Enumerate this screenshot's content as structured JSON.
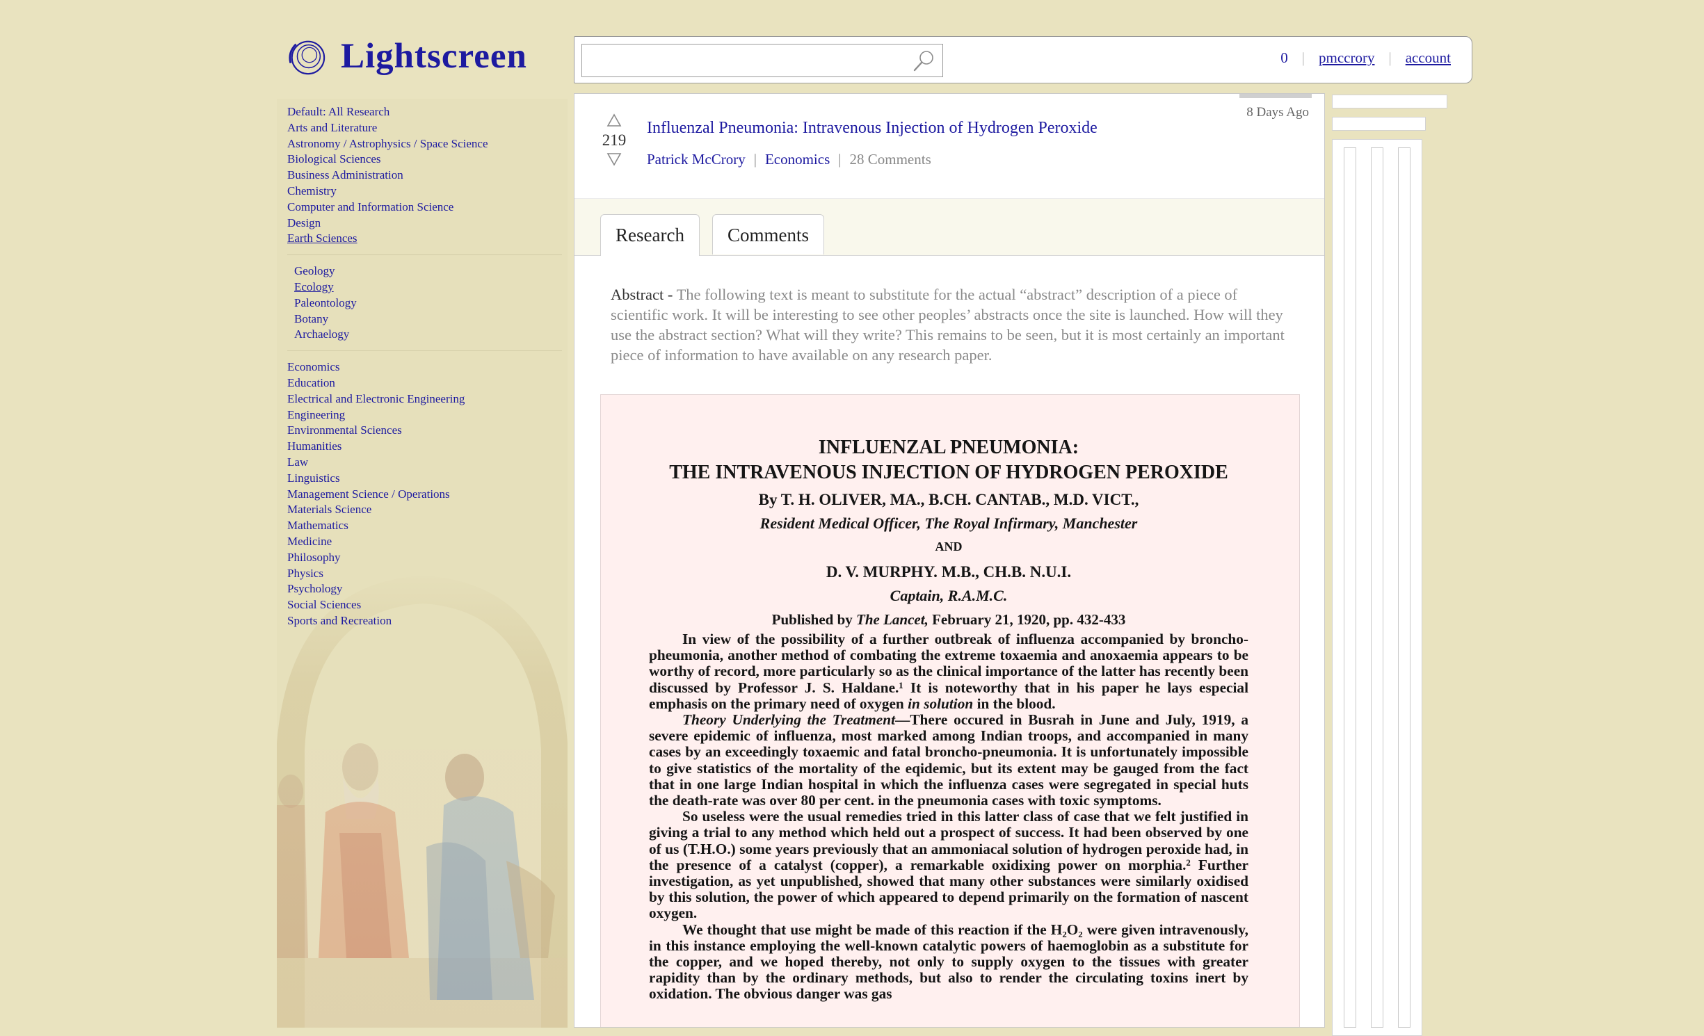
{
  "app": {
    "name": "Lightscreen",
    "logo_icon": "spiral-logo-icon"
  },
  "search": {
    "value": "",
    "placeholder": "",
    "icon": "magnifier-icon"
  },
  "user": {
    "notifications": "0",
    "username": "pmccrory",
    "account_label": "account",
    "separator": "|"
  },
  "sidebar": {
    "categories": [
      "Default: All Research",
      "Arts and Literature",
      "Astronomy / Astrophysics / Space Science",
      "Biological Sciences",
      "Business Administration",
      "Chemistry",
      "Computer and Information Science",
      "Design",
      "Earth Sciences"
    ],
    "subcategories": [
      "Geology",
      "Ecology",
      "Paleontology",
      "Botany",
      "Archaelogy"
    ],
    "categories_after": [
      "Economics",
      "Education",
      "Electrical and Electronic Engineering",
      "Engineering",
      "Environmental Sciences",
      "Humanities",
      "Law",
      "Linguistics",
      "Management Science / Operations",
      "Materials Science",
      "Mathematics",
      "Medicine",
      "Philosophy",
      "Physics",
      "Psychology",
      "Social Sciences",
      "Sports and Recreation"
    ],
    "background_art": "school-of-athens-illustration"
  },
  "post": {
    "age": "8 Days Ago",
    "score": "219",
    "title": "Influenzal Pneumonia: Intravenous Injection of Hydrogen Peroxide",
    "author": "Patrick McCrory",
    "category": "Economics",
    "comments": "28 Comments",
    "separator": "|"
  },
  "tabs": {
    "research": "Research",
    "comments": "Comments"
  },
  "abstract": {
    "label": "Abstract -",
    "text": "The following text is meant to substitute for the actual “abstract” description of a piece of scientific work. It will be interesting to see other peoples’ abstracts once the site is launched. How will they use the abstract section? What will they write? This remains to be seen, but it is most certainly an important piece of information to have available on any research paper."
  },
  "paper": {
    "title_line1": "INFLUENZAL PNEUMONIA:",
    "title_line2": "THE INTRAVENOUS INJECTION OF HYDROGEN PEROXIDE",
    "author1": "By T. H. OLIVER, MA., B.CH. CANTAB., M.D. VICT.,",
    "author1_affil": "Resident Medical Officer, The Royal Infirmary, Manchester",
    "and": "AND",
    "author2": "D. V. MURPHY. M.B., CH.B. N.U.I.",
    "author2_affil": "Captain, R.A.M.C.",
    "pub_prefix": "Published by",
    "pub_journal": "The Lancet,",
    "pub_suffix": "February 21, 1920, pp. 432-433",
    "p1": "In view of the possibility of a further outbreak of influenza accompanied by broncho-pheumonia, another method of combating the extreme toxaemia and anoxaemia appears to be worthy of record, more particularly so as the clinical importance of the latter has recently been discussed by Professor J. S. Haldane.¹ It is noteworthy that in his paper he lays especial emphasis on the primary need of oxygen",
    "p1_italic": "in solution",
    "p1_end": "in the blood.",
    "p2_heading": "Theory Underlying the Treatment",
    "p2": "—There occured in Busrah in June and July, 1919, a severe epidemic of influenza, most marked among Indian troops, and accompanied in many cases by an exceedingly toxaemic and fatal broncho-pneumonia. It is unfortunately impossible to give statistics of the mortality of the eqidemic, but its extent may be gauged from the fact that in one large Indian hospital in which the influenza cases were segregated in special huts the death-rate was over 80 per cent. in the pneumonia cases with toxic symptoms.",
    "p3": "So useless were the usual remedies tried in this latter class of case that we felt justified in giving a trial to any method which held out a prospect of success. It had been observed by one of us (T.H.O.) some years previously that an ammoniacal solution of hydrogen peroxide had, in the presence of a catalyst (copper), a remarkable oxidixing power on morphia.² Further investigation, as yet unpublished, showed that many other substances were similarly oxidised by this solution, the power of which appeared to depend primarily on the formation of nascent oxygen.",
    "p4": "We thought that use might be made of this reaction if the H₂O₂ were given intravenously, in this instance employing the well-known catalytic powers of haemoglobin as a substitute for the copper, and we hoped thereby, not only to supply oxygen to the tissues with greater rapidity than by the ordinary methods, but also to render the circulating toxins inert by oxidation. The obvious danger was gas"
  },
  "colors": {
    "background": "#e9e3bf",
    "link": "#1d1aa0",
    "paper": "#fff0ef"
  }
}
